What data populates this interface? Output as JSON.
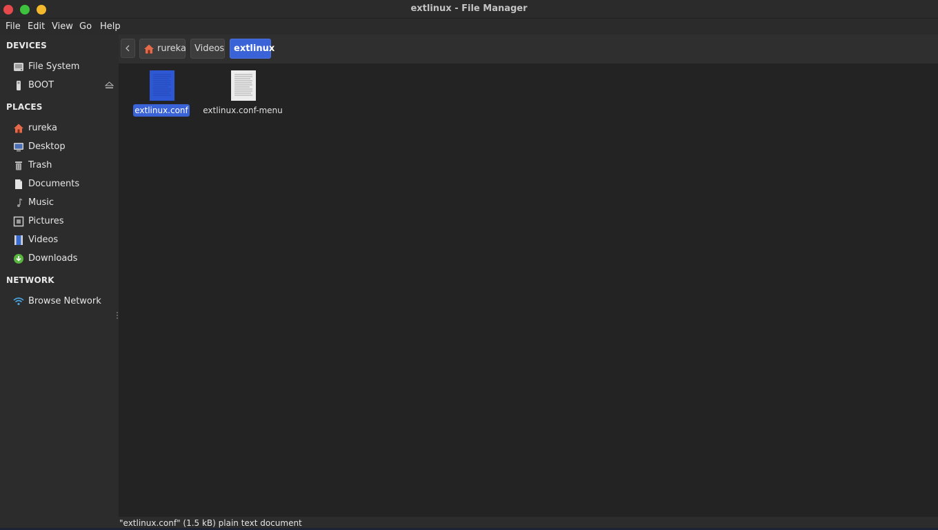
{
  "window": {
    "title": "extlinux - File Manager"
  },
  "menubar": {
    "items": [
      "File",
      "Edit",
      "View",
      "Go",
      "Help"
    ]
  },
  "sidebar": {
    "devices_header": "DEVICES",
    "devices": [
      {
        "label": "File System",
        "icon": "harddisk-icon"
      },
      {
        "label": "BOOT",
        "icon": "usb-drive-icon"
      }
    ],
    "places_header": "PLACES",
    "places": [
      {
        "label": "rureka",
        "icon": "home-icon"
      },
      {
        "label": "Desktop",
        "icon": "desktop-icon"
      },
      {
        "label": "Trash",
        "icon": "trash-icon"
      },
      {
        "label": "Documents",
        "icon": "document-icon"
      },
      {
        "label": "Music",
        "icon": "music-icon"
      },
      {
        "label": "Pictures",
        "icon": "picture-icon"
      },
      {
        "label": "Videos",
        "icon": "video-icon"
      },
      {
        "label": "Downloads",
        "icon": "download-icon"
      }
    ],
    "network_header": "NETWORK",
    "network": [
      {
        "label": "Browse Network",
        "icon": "wifi-icon"
      }
    ]
  },
  "breadcrumb": {
    "items": [
      "rureka",
      "Videos",
      "extlinux"
    ]
  },
  "files": [
    {
      "name": "extlinux.conf",
      "selected": true
    },
    {
      "name": "extlinux.conf-menu",
      "selected": false
    }
  ],
  "status": {
    "text": "\"extlinux.conf\" (1.5 kB) plain text document"
  },
  "colors": {
    "accent": "#3b63d8",
    "close": "#e5494c",
    "maximize": "#3ec23e",
    "minimize": "#f3b82b"
  }
}
